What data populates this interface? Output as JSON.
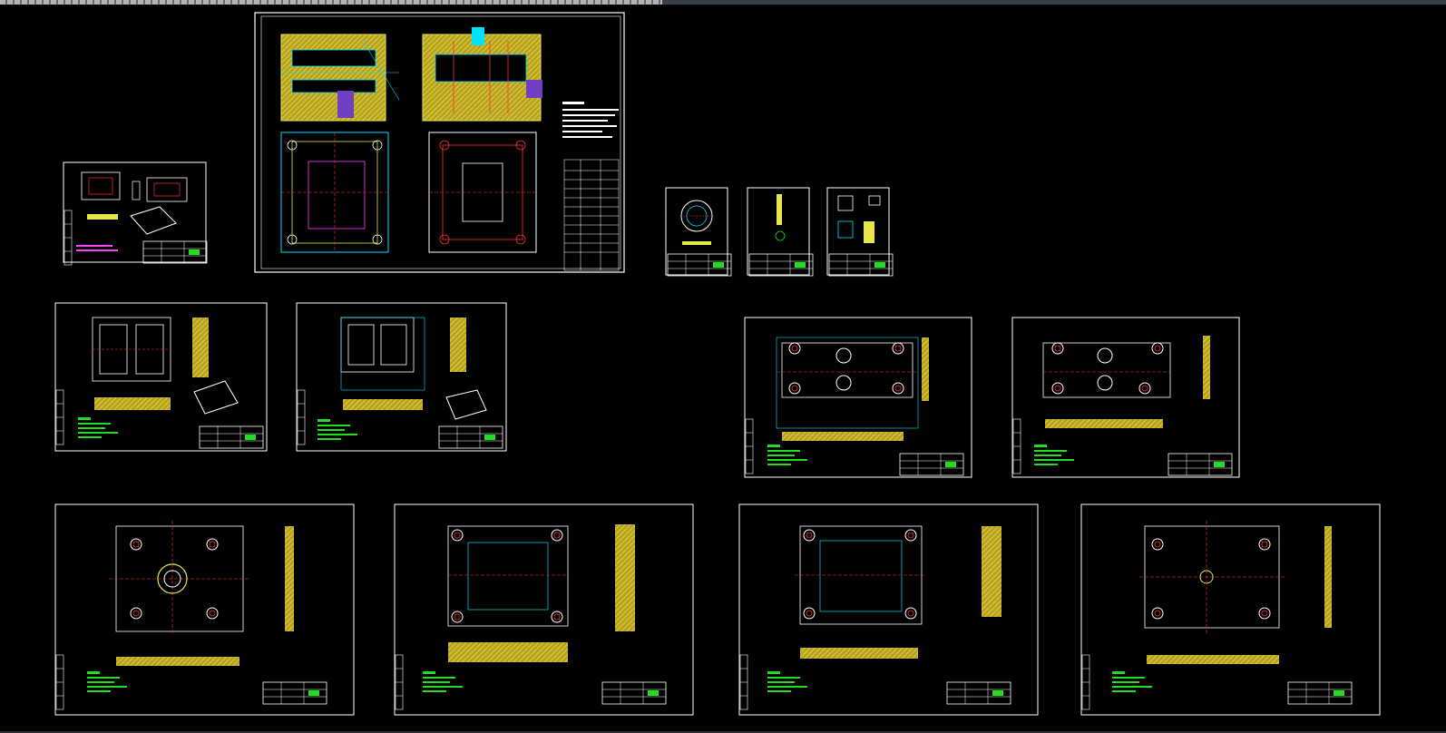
{
  "app": {
    "title_bar_text": "",
    "accent": "#3a3f47"
  },
  "drawing": {
    "background": "#000000",
    "colors": {
      "frame": "#ffffff",
      "cyan": "#00e0ff",
      "yellow": "#e6e64a",
      "green": "#22dd22",
      "red": "#ff3030",
      "magenta": "#ff40ff",
      "hatch": "#c8b020"
    }
  }
}
